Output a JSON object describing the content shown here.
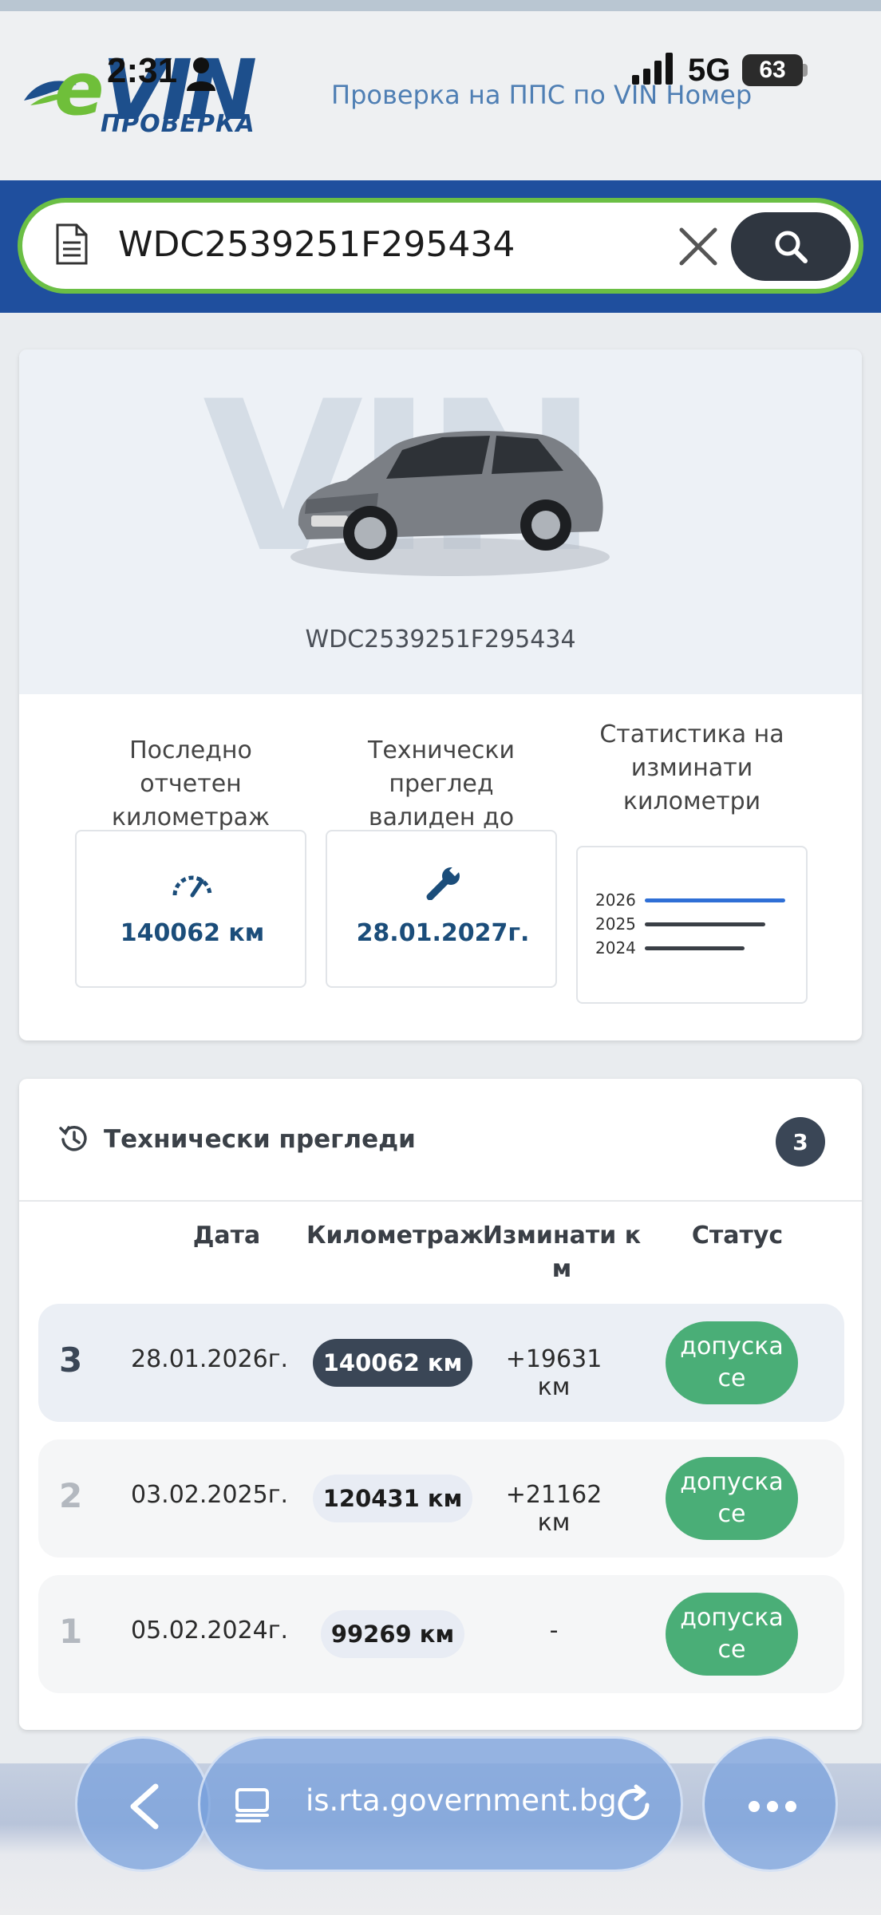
{
  "status_bar": {
    "time": "2:31",
    "network": "5G",
    "battery": "63"
  },
  "header": {
    "logo": {
      "e": "e",
      "vin": "VIN",
      "sub": "ПРОВЕРКА"
    },
    "title": "Проверка на ППС по VIN Номер"
  },
  "search": {
    "value": "WDC2539251F295434"
  },
  "vehicle": {
    "watermark": "VIN",
    "vin": "WDC2539251F295434",
    "stats": [
      {
        "label_lines": [
          "Последно отчетен",
          "километраж"
        ],
        "value": "140062 км",
        "icon": "speedometer-icon"
      },
      {
        "label_lines": [
          "Технически преглед",
          "валиден до"
        ],
        "value": "28.01.2027г.",
        "icon": "wrench-icon"
      },
      {
        "label_lines": [
          "Статистика на",
          "изминати",
          "километри"
        ],
        "icon": "mini-bar-chart"
      }
    ],
    "mileage_mini_chart": {
      "years": [
        "2026",
        "2025",
        "2024"
      ],
      "km": [
        140062,
        120431,
        99269
      ],
      "colors": [
        "#2f6fd6",
        "#3a3f46",
        "#3a3f46"
      ]
    }
  },
  "inspections": {
    "title": "Технически прегледи",
    "count": "3",
    "columns": [
      "Дата",
      "Километраж",
      "Изминати к",
      "м",
      "Статус"
    ],
    "rows": [
      {
        "num": "3",
        "date": "28.01.2026г.",
        "km": "140062 км",
        "diff": "+19631 км",
        "status_1": "допуска",
        "status_2": "се"
      },
      {
        "num": "2",
        "date": "03.02.2025г.",
        "km": "120431 км",
        "diff": "+21162 км",
        "status_1": "допуска",
        "status_2": "се"
      },
      {
        "num": "1",
        "date": "05.02.2024г.",
        "km": "99269 км",
        "diff": "-",
        "status_1": "допуска",
        "status_2": "се"
      }
    ]
  },
  "browser": {
    "url": "is.rta.government.bg"
  },
  "colors": {
    "brand_blue": "#1f4f9e",
    "brand_green": "#6bbf45",
    "status_green": "#4aae77",
    "dark": "#3a4656"
  }
}
